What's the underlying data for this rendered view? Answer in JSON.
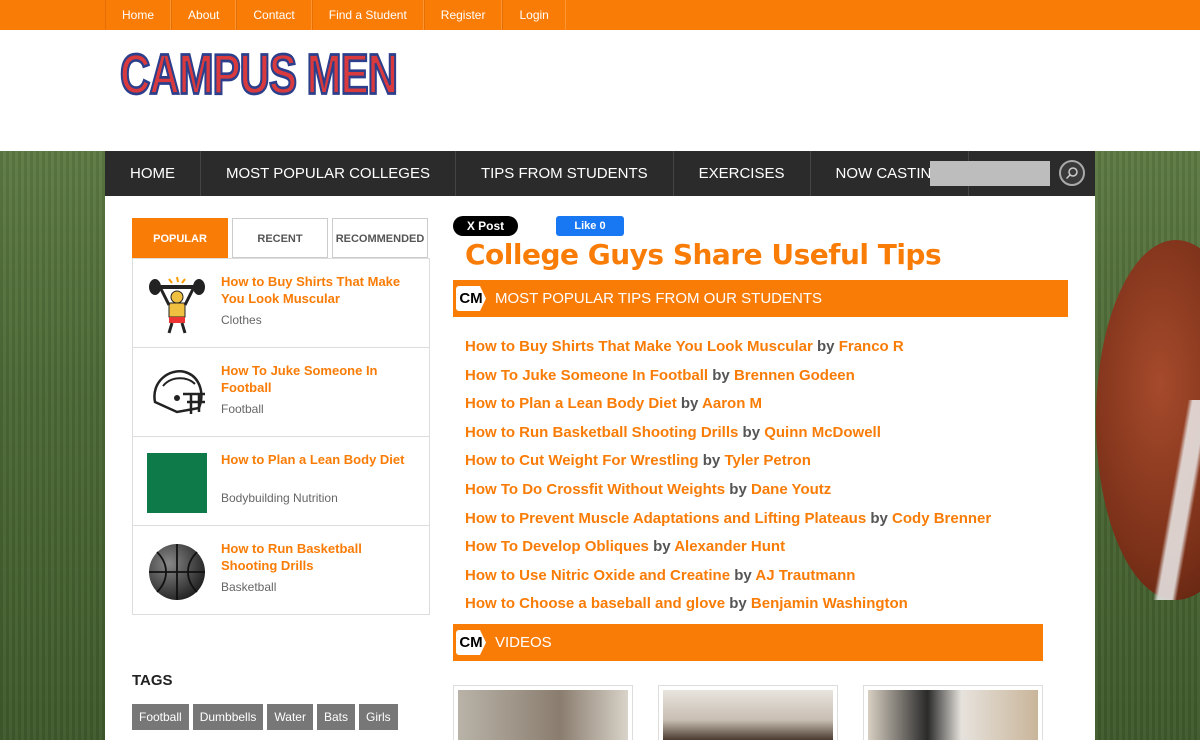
{
  "topnav": [
    "Home",
    "About",
    "Contact",
    "Find a Student",
    "Register",
    "Login"
  ],
  "logo": "CAMPUS MEN",
  "mainnav": [
    "HOME",
    "MOST POPULAR COLLEGES",
    "TIPS FROM STUDENTS",
    "EXERCISES",
    "NOW CASTING"
  ],
  "search": {
    "placeholder": ""
  },
  "sidebar": {
    "tabs": [
      "POPULAR",
      "RECENT",
      "RECOMMENDED"
    ],
    "items": [
      {
        "title": "How to Buy Shirts That Make You Look Muscular",
        "category": "Clothes",
        "icon": "weightlifter-icon"
      },
      {
        "title": "How To Juke Someone In Football",
        "category": "Football",
        "icon": "football-helmet-icon"
      },
      {
        "title": "How to Plan a Lean Body Diet",
        "category": "Bodybuilding Nutrition",
        "icon": "green-square-icon"
      },
      {
        "title": "How to Run Basketball Shooting Drills",
        "category": "Basketball",
        "icon": "basketball-icon"
      }
    ],
    "tags_heading": "TAGS",
    "tags": [
      "Football",
      "Dumbbells",
      "Water",
      "Bats",
      "Girls"
    ]
  },
  "social": {
    "x_post": "X Post",
    "fb_like": "Like 0"
  },
  "page_title": "College Guys Share Useful Tips",
  "sections": {
    "tips_heading": "MOST POPULAR TIPS FROM OUR STUDENTS",
    "videos_heading": "VIDEOS",
    "badge": "CM"
  },
  "tips": [
    {
      "title": "How to Buy Shirts That Make You Look Muscular",
      "author": "Franco R"
    },
    {
      "title": "How To Juke Someone In Football",
      "author": "Brennen Godeen"
    },
    {
      "title": "How to Plan a Lean Body Diet",
      "author": "Aaron M"
    },
    {
      "title": "How to Run Basketball Shooting Drills",
      "author": "Quinn McDowell"
    },
    {
      "title": "How to Cut Weight For Wrestling",
      "author": "Tyler Petron"
    },
    {
      "title": "How To Do Crossfit Without Weights",
      "author": "Dane Youtz"
    },
    {
      "title": "How to Prevent Muscle Adaptations and Lifting Plateaus",
      "author": "Cody Brenner"
    },
    {
      "title": "How To Develop Obliques",
      "author": "Alexander Hunt"
    },
    {
      "title": "How to Use Nitric Oxide and Creatine",
      "author": "AJ Trautmann"
    },
    {
      "title": "How to Choose a baseball and glove",
      "author": "Benjamin Washington"
    }
  ],
  "by_word": "by",
  "colors": {
    "accent": "#f97c07",
    "nav_dark": "#2b2b2b"
  }
}
